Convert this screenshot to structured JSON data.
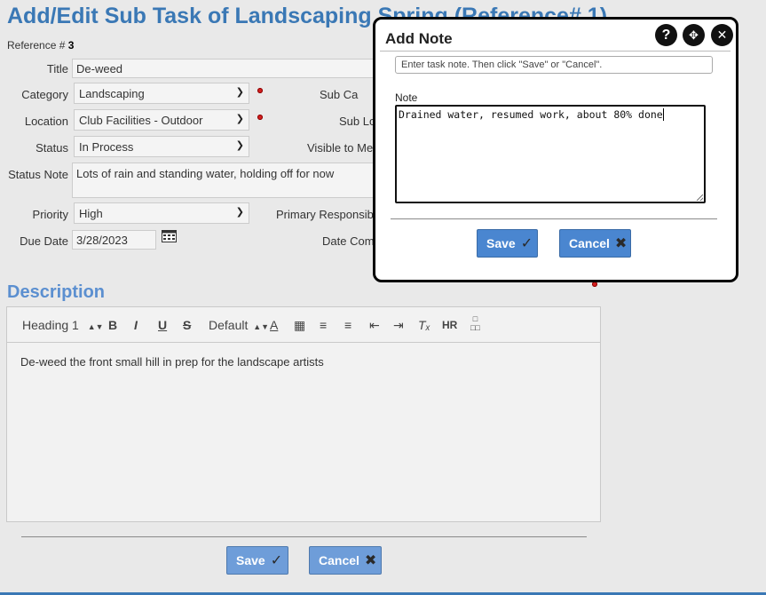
{
  "page": {
    "title": "Add/Edit Sub Task of Landscaping Spring (Reference# 1)",
    "reference_label": "Reference #",
    "reference_value": "3"
  },
  "form": {
    "title_label": "Title",
    "title_value": "De-weed",
    "category_label": "Category",
    "category_value": "Landscaping",
    "subcat_label": "Sub Ca",
    "location_label": "Location",
    "location_value": "Club Facilities - Outdoor",
    "subloc_label": "Sub Lo",
    "status_label": "Status",
    "status_value": "In Process",
    "visible_label": "Visible to Me",
    "status_note_label": "Status Note",
    "status_note_value": "Lots of rain and standing water, holding off for now",
    "priority_label": "Priority",
    "priority_value": "High",
    "primary_resp_label": "Primary Responsib",
    "due_date_label": "Due Date",
    "due_date_value": "3/28/2023",
    "date_comp_label": "Date Com"
  },
  "description": {
    "heading": "Description",
    "toolbar": {
      "heading_select": "Heading 1",
      "bold": "B",
      "italic": "I",
      "underline": "U",
      "strike": "S",
      "font_select": "Default",
      "hr": "HR"
    },
    "content": "De-weed the front small hill in prep for the landscape artists"
  },
  "buttons": {
    "save": "Save",
    "cancel": "Cancel"
  },
  "modal": {
    "title": "Add Note",
    "hint": "Enter task note. Then click \"Save\" or \"Cancel\".",
    "note_label": "Note",
    "note_value": "Drained water, resumed work, about 80% done",
    "save": "Save",
    "cancel": "Cancel"
  }
}
